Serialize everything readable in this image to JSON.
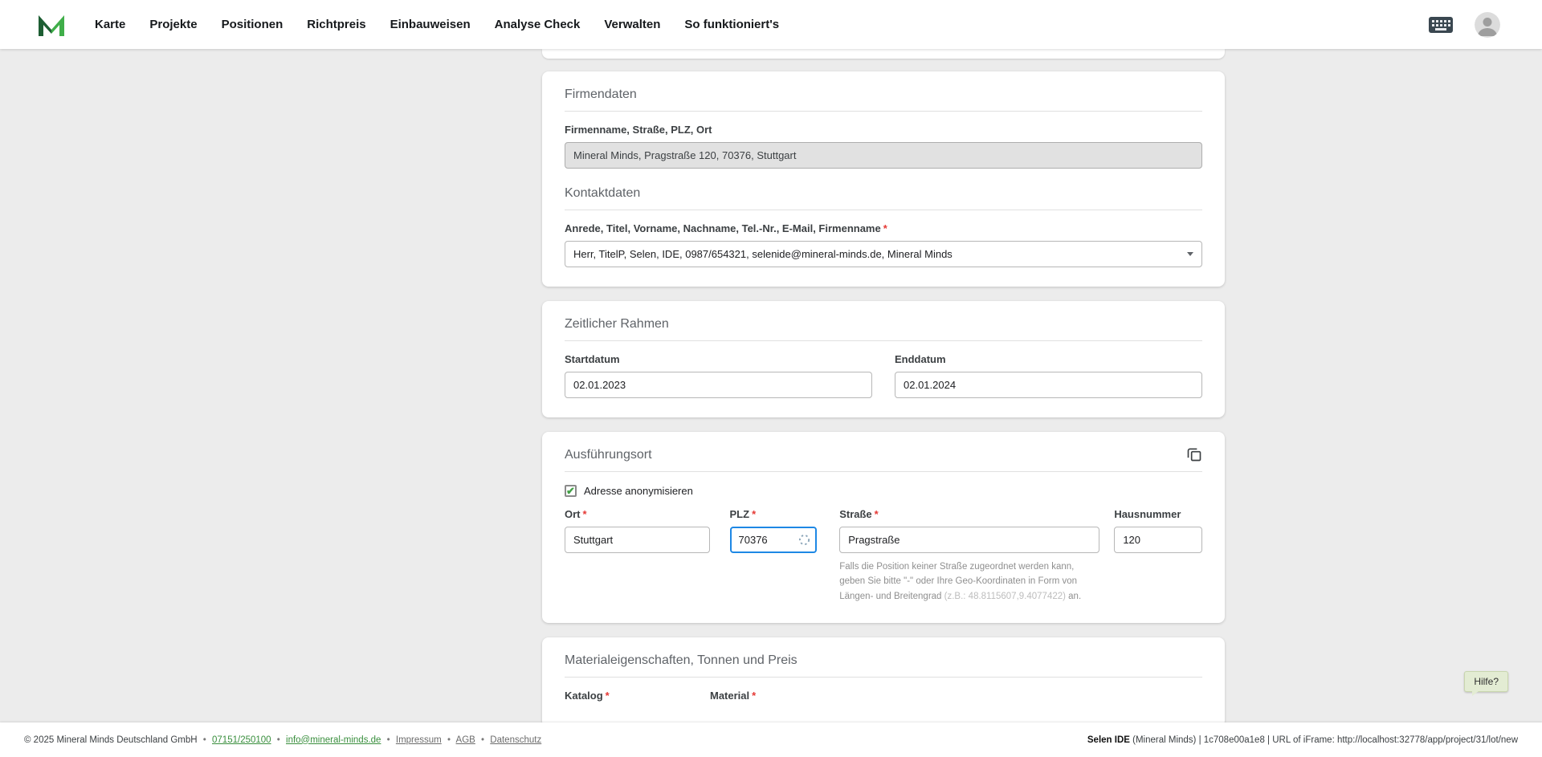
{
  "required_mark": "*",
  "icons": {
    "check": "✔"
  },
  "colors": {
    "brand_green_dark": "#1d5e33",
    "brand_green": "#3fae49",
    "focus_blue": "#1e88e5",
    "required_red": "#e53935",
    "link_green": "#388e3c"
  },
  "navbar": {
    "items": [
      "Karte",
      "Projekte",
      "Positionen",
      "Richtpreis",
      "Einbauweisen",
      "Analyse Check",
      "Verwalten",
      "So funktioniert's"
    ]
  },
  "firmendaten": {
    "title": "Firmendaten",
    "company_label": "Firmenname, Straße, PLZ, Ort",
    "company_value": "Mineral Minds, Pragstraße 120, 70376, Stuttgart",
    "kontakt_title": "Kontaktdaten",
    "kontakt_label": "Anrede, Titel, Vorname, Nachname, Tel.-Nr., E-Mail, Firmenname",
    "kontakt_value": "Herr, TitelP, Selen, IDE, 0987/654321, selenide@mineral-minds.de, Mineral Minds"
  },
  "zeitraum": {
    "title": "Zeitlicher Rahmen",
    "start_label": "Startdatum",
    "start_value": "02.01.2023",
    "end_label": "Enddatum",
    "end_value": "02.01.2024"
  },
  "ausfuehrungsort": {
    "title": "Ausführungsort",
    "anonymisieren_label": "Adresse anonymisieren",
    "ort_label": "Ort",
    "ort_value": "Stuttgart",
    "plz_label": "PLZ",
    "plz_value": "70376",
    "strasse_label": "Straße",
    "strasse_value": "Pragstraße",
    "hausnummer_label": "Hausnummer",
    "hausnummer_value": "120",
    "hint_main": "Falls die Position keiner Straße zugeordnet werden kann, geben Sie bitte \"-\" oder Ihre Geo-Koordinaten in Form von Längen- und Breitengrad ",
    "hint_light": "(z.B.: 48.8115607,9.4077422)",
    "hint_end": " an."
  },
  "material": {
    "title": "Materialeigenschaften, Tonnen und Preis",
    "katalog_label": "Katalog",
    "material_label": "Material"
  },
  "hilfe": {
    "label": "Hilfe?"
  },
  "footer": {
    "separator": "•",
    "copyright": "© 2025 Mineral Minds Deutschland GmbH",
    "phone": "07151/250100",
    "email": "info@mineral-minds.de",
    "impressum": "Impressum",
    "agb": "AGB",
    "datenschutz": "Datenschutz",
    "right_bold": "Selen IDE",
    "right_rest": " (Mineral Minds) | 1c708e00a1e8 | URL of iFrame: http://localhost:32778/app/project/31/lot/new"
  }
}
